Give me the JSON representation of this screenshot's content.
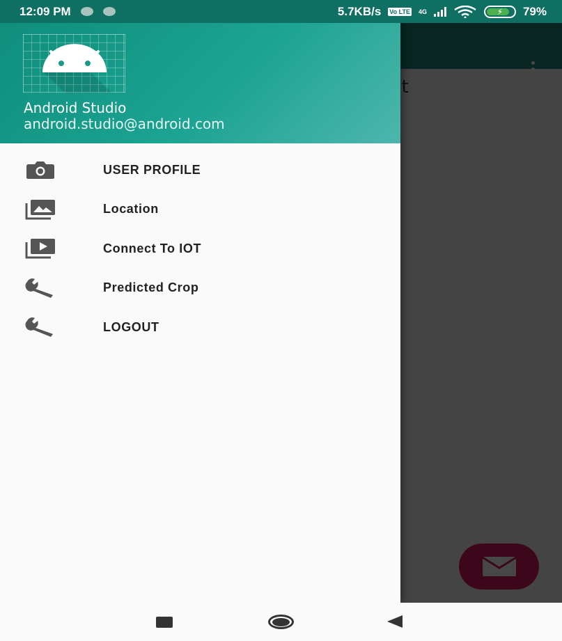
{
  "status_bar": {
    "time": "12:09 PM",
    "net_speed": "5.7KB/s",
    "volte": "Vo LTE",
    "net_type": "4G",
    "battery": "79%"
  },
  "background": {
    "content_text_fragment": "nt"
  },
  "drawer": {
    "header": {
      "name": "Android Studio",
      "email": "android.studio@android.com",
      "logo_icon": "android-icon"
    },
    "items": [
      {
        "label": "USER PROFILE",
        "icon": "camera-icon"
      },
      {
        "label": "Location",
        "icon": "gallery-icon"
      },
      {
        "label": "Connect To IOT",
        "icon": "slideshow-icon"
      },
      {
        "label": "Predicted Crop",
        "icon": "wrench-icon"
      },
      {
        "label": "LOGOUT",
        "icon": "wrench-icon"
      }
    ]
  },
  "colors": {
    "primary": "#1d8577",
    "header_gradient_end": "#4db6ac",
    "fab": "#d81b60"
  }
}
